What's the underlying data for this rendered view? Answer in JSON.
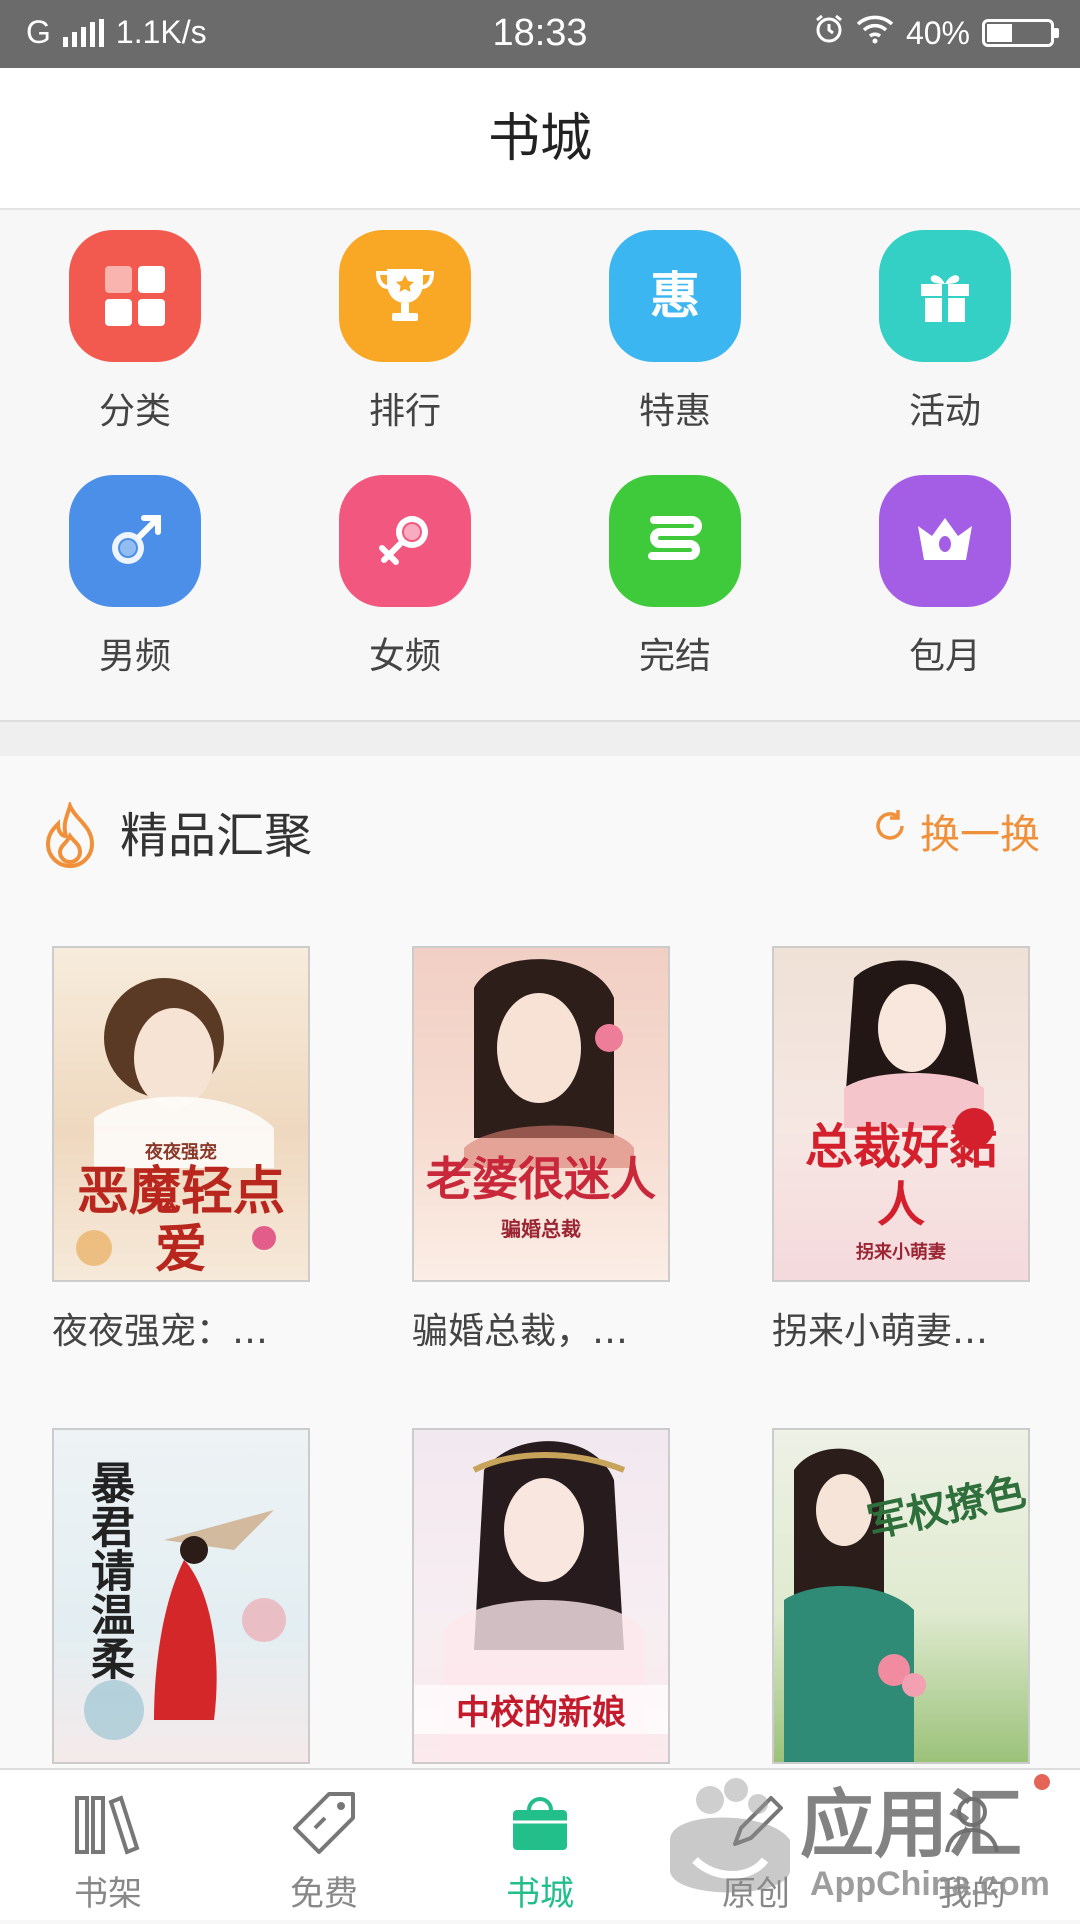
{
  "status": {
    "network": "G",
    "speed": "1.1K/s",
    "time": "18:33",
    "battery": "40%",
    "battery_level": 0.4
  },
  "header": {
    "title": "书城"
  },
  "categories": [
    {
      "label": "分类",
      "icon": "grid-icon",
      "color": "#f2594f"
    },
    {
      "label": "排行",
      "icon": "trophy-icon",
      "color": "#f9a825"
    },
    {
      "label": "特惠",
      "icon": "discount-icon",
      "color": "#3cb6f0"
    },
    {
      "label": "活动",
      "icon": "gift-icon",
      "color": "#35d0c5"
    },
    {
      "label": "男频",
      "icon": "male-icon",
      "color": "#4b8fe8"
    },
    {
      "label": "女频",
      "icon": "female-icon",
      "color": "#f2577f"
    },
    {
      "label": "完结",
      "icon": "complete-icon",
      "color": "#3fca3b"
    },
    {
      "label": "包月",
      "icon": "crown-icon",
      "color": "#a45ee6"
    }
  ],
  "section": {
    "title": "精品汇聚",
    "refresh": "换一换"
  },
  "books": [
    {
      "name": "夜夜强宠：…",
      "cover_text": "恶魔轻点爱",
      "cover_sub": "夜夜强宠",
      "bg": "#f4e6d3",
      "tc": "#b8261e"
    },
    {
      "name": "骗婚总裁，…",
      "cover_text": "老婆很迷人",
      "cover_sub": "骗婚总裁",
      "bg": "#f6d8cf",
      "tc": "#c8283a"
    },
    {
      "name": "拐来小萌妻…",
      "cover_text": "总裁好黏人",
      "cover_sub": "拐来小萌妻",
      "bg": "#f2e0dc",
      "tc": "#d4202c"
    },
    {
      "name": "",
      "cover_text": "暴君请温柔",
      "cover_sub": "",
      "bg": "#e7eef2",
      "tc": "#222222"
    },
    {
      "name": "",
      "cover_text": "中校的新娘",
      "cover_sub": "",
      "bg": "#f5e4ea",
      "tc": "#c41b2c"
    },
    {
      "name": "",
      "cover_text": "军权撩色",
      "cover_sub": "",
      "bg": "#e2eee0",
      "tc": "#2f6f3c"
    }
  ],
  "tabs": [
    {
      "label": "书架",
      "icon": "bookshelf-icon",
      "active": false
    },
    {
      "label": "免费",
      "icon": "tag-icon",
      "active": false
    },
    {
      "label": "书城",
      "icon": "bag-icon",
      "active": true
    },
    {
      "label": "原创",
      "icon": "pen-icon",
      "active": false
    },
    {
      "label": "我的",
      "icon": "person-icon",
      "active": false
    }
  ],
  "watermark": {
    "text": "应用汇",
    "sub": "AppChina.com"
  }
}
